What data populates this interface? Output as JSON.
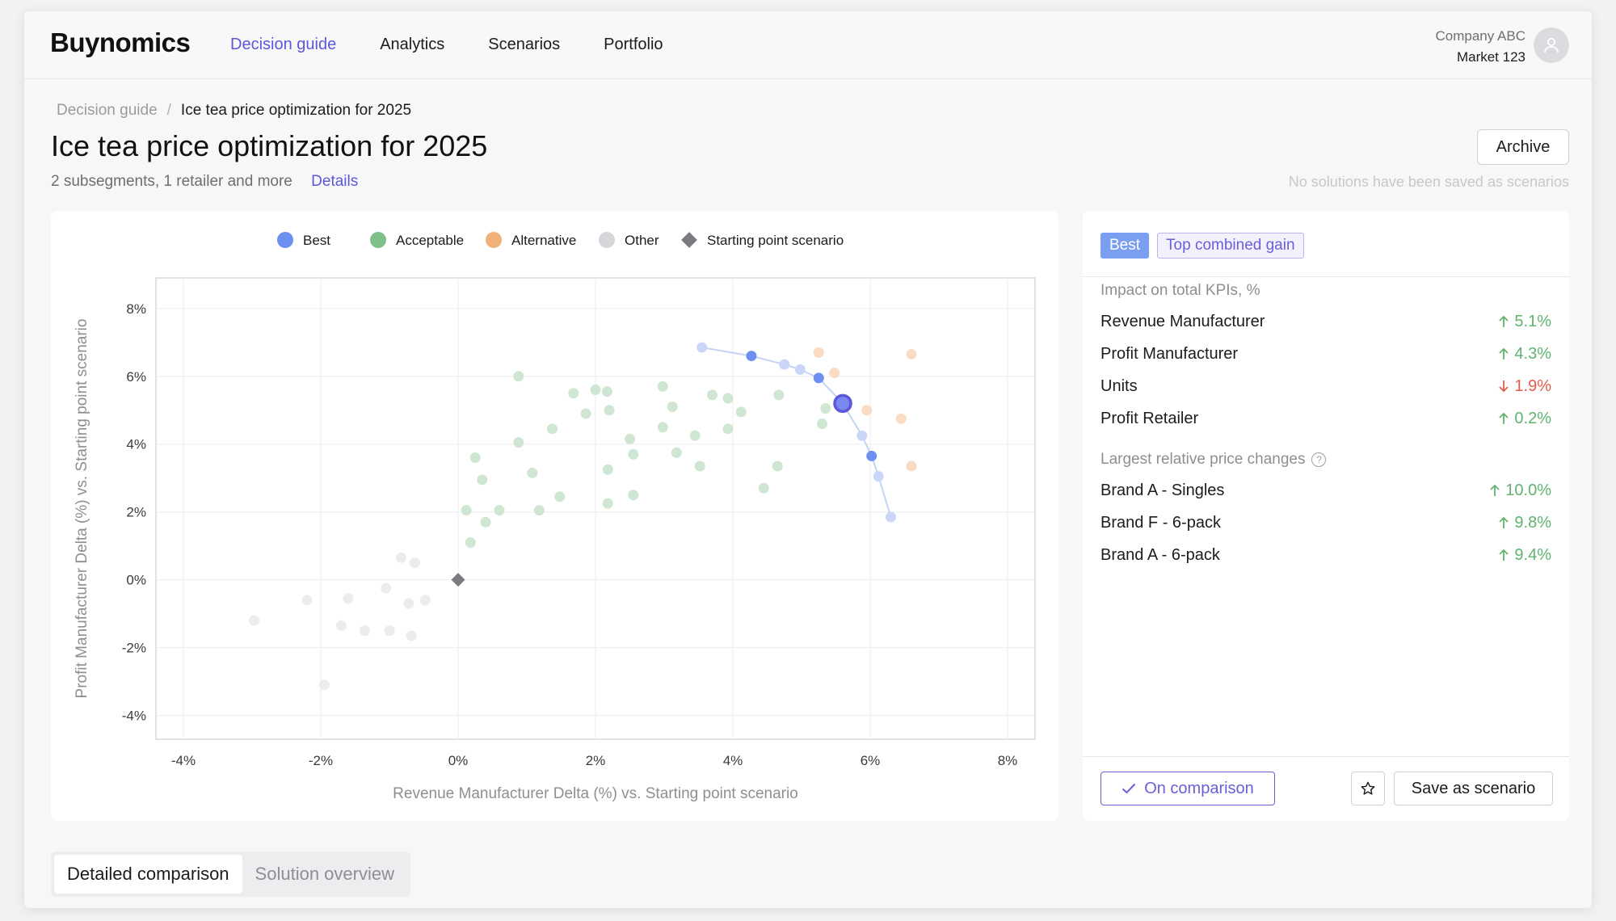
{
  "app": {
    "logo": "Buynomics"
  },
  "nav": [
    {
      "label": "Decision guide",
      "active": true
    },
    {
      "label": "Analytics",
      "active": false
    },
    {
      "label": "Scenarios",
      "active": false
    },
    {
      "label": "Portfolio",
      "active": false
    }
  ],
  "account": {
    "company": "Company ABC",
    "market": "Market 123",
    "avatar_icon": "user-icon"
  },
  "breadcrumb": {
    "root": "Decision guide",
    "separator": "/",
    "current": "Ice tea price optimization for 2025"
  },
  "page": {
    "title": "Ice tea price optimization for 2025",
    "subtitle": "2 subsegments, 1 retailer and more",
    "details_link": "Details",
    "archive_label": "Archive",
    "no_solutions_text": "No solutions have been saved as scenarios"
  },
  "colors": {
    "accent": "#5b57d9",
    "best": "#6d8ff0",
    "acceptable": "#7fbf8a",
    "alternative": "#f0b27a",
    "other": "#d6d6da",
    "start": "#7a7a80",
    "up": "#62b271",
    "down": "#e25c4e"
  },
  "chart_data": {
    "type": "scatter",
    "xlabel": "Revenue Manufacturer Delta (%) vs. Starting point scenario",
    "ylabel": "Profit Manufacturer Delta (%) vs. Starting point scenario",
    "xlim": [
      -4.4,
      8.4
    ],
    "ylim": [
      -4.7,
      8.9
    ],
    "xticks": [
      -4,
      -2,
      0,
      2,
      4,
      6,
      8
    ],
    "yticks": [
      -4,
      -2,
      0,
      2,
      4,
      6,
      8
    ],
    "tick_suffix": "%",
    "grid": true,
    "legend_position": "top",
    "legend": [
      {
        "label": "Best",
        "color": "#6d8ff0",
        "shape": "circle"
      },
      {
        "label": "Acceptable",
        "color": "#7fbf8a",
        "shape": "circle"
      },
      {
        "label": "Alternative",
        "color": "#f0b27a",
        "shape": "circle"
      },
      {
        "label": "Other",
        "color": "#d6d6da",
        "shape": "circle"
      },
      {
        "label": "Starting point scenario",
        "color": "#7a7a80",
        "shape": "diamond"
      }
    ],
    "series": [
      {
        "name": "Best",
        "color": "#6d8ff0",
        "frontier": true,
        "points": [
          [
            3.55,
            6.85
          ],
          [
            4.27,
            6.6
          ],
          [
            4.75,
            6.35
          ],
          [
            4.98,
            6.2
          ],
          [
            5.25,
            5.95
          ],
          [
            5.6,
            5.2
          ],
          [
            5.88,
            4.25
          ],
          [
            6.02,
            3.65
          ],
          [
            6.12,
            3.05
          ],
          [
            6.3,
            1.85
          ]
        ],
        "emphasized": [
          1,
          4,
          7
        ],
        "selected": 5
      },
      {
        "name": "Acceptable",
        "color": "#7fbf8a",
        "points": [
          [
            0.88,
            6.0
          ],
          [
            1.68,
            5.5
          ],
          [
            2.0,
            5.6
          ],
          [
            2.17,
            5.55
          ],
          [
            2.2,
            5.0
          ],
          [
            1.86,
            4.9
          ],
          [
            1.37,
            4.45
          ],
          [
            0.88,
            4.05
          ],
          [
            0.25,
            3.6
          ],
          [
            0.35,
            2.95
          ],
          [
            0.12,
            2.05
          ],
          [
            0.4,
            1.7
          ],
          [
            0.6,
            2.05
          ],
          [
            0.18,
            1.1
          ],
          [
            1.08,
            3.15
          ],
          [
            1.18,
            2.05
          ],
          [
            1.48,
            2.45
          ],
          [
            2.18,
            3.25
          ],
          [
            2.18,
            2.25
          ],
          [
            2.55,
            2.5
          ],
          [
            2.5,
            4.15
          ],
          [
            2.55,
            3.7
          ],
          [
            2.98,
            5.7
          ],
          [
            3.12,
            5.1
          ],
          [
            2.98,
            4.5
          ],
          [
            3.18,
            3.75
          ],
          [
            3.45,
            4.25
          ],
          [
            3.52,
            3.35
          ],
          [
            3.7,
            5.45
          ],
          [
            3.93,
            5.35
          ],
          [
            4.12,
            4.95
          ],
          [
            3.93,
            4.45
          ],
          [
            4.67,
            5.45
          ],
          [
            4.45,
            2.7
          ],
          [
            4.65,
            3.35
          ],
          [
            5.35,
            5.05
          ],
          [
            5.3,
            4.6
          ]
        ]
      },
      {
        "name": "Alternative",
        "color": "#f0b27a",
        "points": [
          [
            5.25,
            6.7
          ],
          [
            5.48,
            6.1
          ],
          [
            5.95,
            5.0
          ],
          [
            6.6,
            6.65
          ],
          [
            6.45,
            4.75
          ],
          [
            6.6,
            3.35
          ]
        ]
      },
      {
        "name": "Other",
        "color": "#d6d6da",
        "points": [
          [
            -2.97,
            -1.2
          ],
          [
            -2.2,
            -0.6
          ],
          [
            -1.7,
            -1.35
          ],
          [
            -1.6,
            -0.55
          ],
          [
            -1.36,
            -1.5
          ],
          [
            -1.05,
            -0.25
          ],
          [
            -1.0,
            -1.5
          ],
          [
            -0.83,
            0.65
          ],
          [
            -0.72,
            -0.7
          ],
          [
            -0.63,
            0.5
          ],
          [
            -0.68,
            -1.65
          ],
          [
            -0.48,
            -0.6
          ],
          [
            -1.95,
            -3.1
          ]
        ]
      },
      {
        "name": "Starting point scenario",
        "color": "#7a7a80",
        "shape": "diamond",
        "points": [
          [
            0.0,
            0.0
          ]
        ]
      }
    ]
  },
  "solution": {
    "badge_best": "Best",
    "badge_gain": "Top combined gain",
    "kpi_section": "Impact on total KPIs, %",
    "kpis": [
      {
        "name": "Revenue Manufacturer",
        "value": "5.1%",
        "direction": "up"
      },
      {
        "name": "Profit Manufacturer",
        "value": "4.3%",
        "direction": "up"
      },
      {
        "name": "Units",
        "value": "1.9%",
        "direction": "down"
      },
      {
        "name": "Profit Retailer",
        "value": "0.2%",
        "direction": "up"
      }
    ],
    "price_section": "Largest relative price changes",
    "price_changes": [
      {
        "name": "Brand A - Singles",
        "value": "10.0%",
        "direction": "up"
      },
      {
        "name": "Brand F - 6-pack",
        "value": "9.8%",
        "direction": "up"
      },
      {
        "name": "Brand A - 6-pack",
        "value": "9.4%",
        "direction": "up"
      }
    ],
    "on_comparison_label": "On comparison",
    "save_label": "Save as scenario"
  },
  "tabs": [
    {
      "label": "Detailed comparison",
      "active": true
    },
    {
      "label": "Solution overview",
      "active": false
    }
  ]
}
